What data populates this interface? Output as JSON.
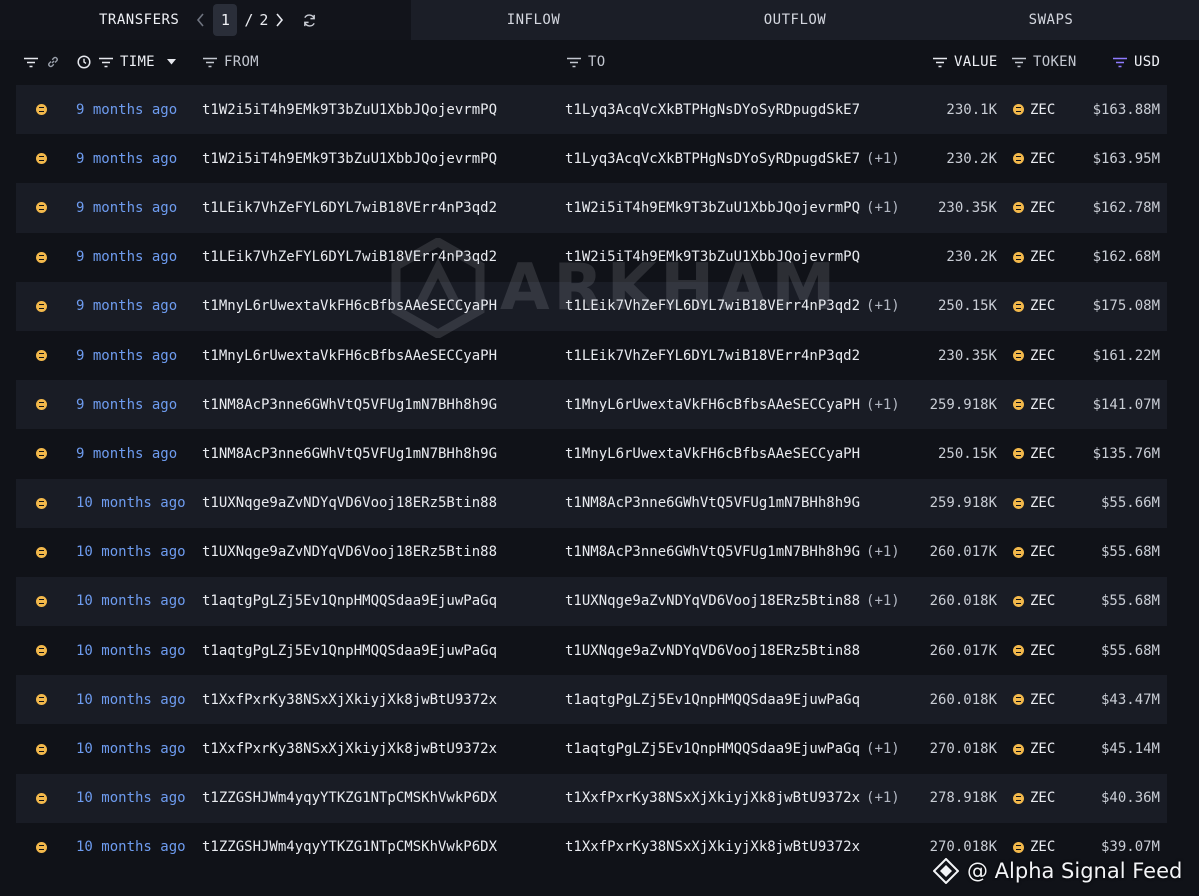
{
  "tabs": {
    "transfers": "TRANSFERS",
    "inflow": "INFLOW",
    "outflow": "OUTFLOW",
    "swaps": "SWAPS"
  },
  "pager": {
    "current": "1",
    "separator": "/",
    "total": "2"
  },
  "columns": {
    "time": "TIME",
    "from": "FROM",
    "to": "TO",
    "value": "VALUE",
    "token": "TOKEN",
    "usd": "USD"
  },
  "colors": {
    "accent_time": "#6e9cf0",
    "zec_token": "#f2b84b",
    "usd_filter_active": "#8f7bff",
    "row_odd": "#191c25",
    "background": "#101218"
  },
  "rows": [
    {
      "time": "9 months ago",
      "from": "t1W2i5iT4h9EMk9T3bZuU1XbbJQojevrmPQ",
      "to": "t1Lyq3AcqVcXkBTPHgNsDYoSyRDpugdSkE7",
      "plus": "",
      "value": "230.1K",
      "token": "ZEC",
      "usd": "$163.88M"
    },
    {
      "time": "9 months ago",
      "from": "t1W2i5iT4h9EMk9T3bZuU1XbbJQojevrmPQ",
      "to": "t1Lyq3AcqVcXkBTPHgNsDYoSyRDpugdSkE7",
      "plus": "(+1)",
      "value": "230.2K",
      "token": "ZEC",
      "usd": "$163.95M"
    },
    {
      "time": "9 months ago",
      "from": "t1LEik7VhZeFYL6DYL7wiB18VErr4nP3qd2",
      "to": "t1W2i5iT4h9EMk9T3bZuU1XbbJQojevrmPQ",
      "plus": "(+1)",
      "value": "230.35K",
      "token": "ZEC",
      "usd": "$162.78M"
    },
    {
      "time": "9 months ago",
      "from": "t1LEik7VhZeFYL6DYL7wiB18VErr4nP3qd2",
      "to": "t1W2i5iT4h9EMk9T3bZuU1XbbJQojevrmPQ",
      "plus": "",
      "value": "230.2K",
      "token": "ZEC",
      "usd": "$162.68M"
    },
    {
      "time": "9 months ago",
      "from": "t1MnyL6rUwextaVkFH6cBfbsAAeSECCyaPH",
      "to": "t1LEik7VhZeFYL6DYL7wiB18VErr4nP3qd2",
      "plus": "(+1)",
      "value": "250.15K",
      "token": "ZEC",
      "usd": "$175.08M"
    },
    {
      "time": "9 months ago",
      "from": "t1MnyL6rUwextaVkFH6cBfbsAAeSECCyaPH",
      "to": "t1LEik7VhZeFYL6DYL7wiB18VErr4nP3qd2",
      "plus": "",
      "value": "230.35K",
      "token": "ZEC",
      "usd": "$161.22M"
    },
    {
      "time": "9 months ago",
      "from": "t1NM8AcP3nne6GWhVtQ5VFUg1mN7BHh8h9G",
      "to": "t1MnyL6rUwextaVkFH6cBfbsAAeSECCyaPH",
      "plus": "(+1)",
      "value": "259.918K",
      "token": "ZEC",
      "usd": "$141.07M"
    },
    {
      "time": "9 months ago",
      "from": "t1NM8AcP3nne6GWhVtQ5VFUg1mN7BHh8h9G",
      "to": "t1MnyL6rUwextaVkFH6cBfbsAAeSECCyaPH",
      "plus": "",
      "value": "250.15K",
      "token": "ZEC",
      "usd": "$135.76M"
    },
    {
      "time": "10 months ago",
      "from": "t1UXNqge9aZvNDYqVD6Vooj18ERz5Btin88",
      "to": "t1NM8AcP3nne6GWhVtQ5VFUg1mN7BHh8h9G",
      "plus": "",
      "value": "259.918K",
      "token": "ZEC",
      "usd": "$55.66M"
    },
    {
      "time": "10 months ago",
      "from": "t1UXNqge9aZvNDYqVD6Vooj18ERz5Btin88",
      "to": "t1NM8AcP3nne6GWhVtQ5VFUg1mN7BHh8h9G",
      "plus": "(+1)",
      "value": "260.017K",
      "token": "ZEC",
      "usd": "$55.68M"
    },
    {
      "time": "10 months ago",
      "from": "t1aqtgPgLZj5Ev1QnpHMQQSdaa9EjuwPaGq",
      "to": "t1UXNqge9aZvNDYqVD6Vooj18ERz5Btin88",
      "plus": "(+1)",
      "value": "260.018K",
      "token": "ZEC",
      "usd": "$55.68M"
    },
    {
      "time": "10 months ago",
      "from": "t1aqtgPgLZj5Ev1QnpHMQQSdaa9EjuwPaGq",
      "to": "t1UXNqge9aZvNDYqVD6Vooj18ERz5Btin88",
      "plus": "",
      "value": "260.017K",
      "token": "ZEC",
      "usd": "$55.68M"
    },
    {
      "time": "10 months ago",
      "from": "t1XxfPxrKy38NSxXjXkiyjXk8jwBtU9372x",
      "to": "t1aqtgPgLZj5Ev1QnpHMQQSdaa9EjuwPaGq",
      "plus": "",
      "value": "260.018K",
      "token": "ZEC",
      "usd": "$43.47M"
    },
    {
      "time": "10 months ago",
      "from": "t1XxfPxrKy38NSxXjXkiyjXk8jwBtU9372x",
      "to": "t1aqtgPgLZj5Ev1QnpHMQQSdaa9EjuwPaGq",
      "plus": "(+1)",
      "value": "270.018K",
      "token": "ZEC",
      "usd": "$45.14M"
    },
    {
      "time": "10 months ago",
      "from": "t1ZZGSHJWm4yqyYTKZG1NTpCMSKhVwkP6DX",
      "to": "t1XxfPxrKy38NSxXjXkiyjXk8jwBtU9372x",
      "plus": "(+1)",
      "value": "278.918K",
      "token": "ZEC",
      "usd": "$40.36M"
    },
    {
      "time": "10 months ago",
      "from": "t1ZZGSHJWm4yqyYTKZG1NTpCMSKhVwkP6DX",
      "to": "t1XxfPxrKy38NSxXjXkiyjXk8jwBtU9372x",
      "plus": "",
      "value": "270.018K",
      "token": "ZEC",
      "usd": "$39.07M"
    }
  ],
  "watermark": {
    "text": "ARKHAM"
  },
  "credit": {
    "text": "@ Alpha Signal Feed"
  },
  "icons": {
    "filter": "filter-icon",
    "link": "link-icon",
    "clock": "clock-icon",
    "sort": "caret-down-icon",
    "refresh": "refresh-icon",
    "entity": "entity-icon",
    "token": "zec-icon"
  }
}
